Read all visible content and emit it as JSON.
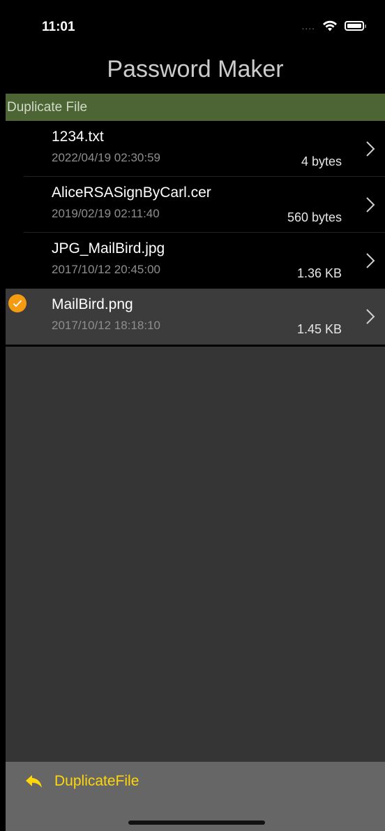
{
  "status_bar": {
    "time": "11:01",
    "signal": "....",
    "wifi_icon": "wifi-icon",
    "battery_icon": "battery-icon"
  },
  "nav": {
    "title": "Password Maker"
  },
  "section": {
    "title": "Duplicate File"
  },
  "files": [
    {
      "name": "1234.txt",
      "date": "2022/04/19  02:30:59",
      "size": "4 bytes",
      "selected": false
    },
    {
      "name": "AliceRSASignByCarl.cer",
      "date": "2019/02/19  02:11:40",
      "size": "560 bytes",
      "selected": false
    },
    {
      "name": "JPG_MailBird.jpg",
      "date": "2017/10/12  20:45:00",
      "size": "1.36 KB",
      "selected": false
    },
    {
      "name": "MailBird.png",
      "date": "2017/10/12  18:18:10",
      "size": "1.45 KB",
      "selected": true
    }
  ],
  "toolbar": {
    "button_label": "DuplicateFile",
    "button_icon": "reply-arrow-icon"
  },
  "colors": {
    "section_bg": "#4d6535",
    "accent": "#ffd60a",
    "check": "#f39c12",
    "selected_row": "#3c3c3c"
  }
}
